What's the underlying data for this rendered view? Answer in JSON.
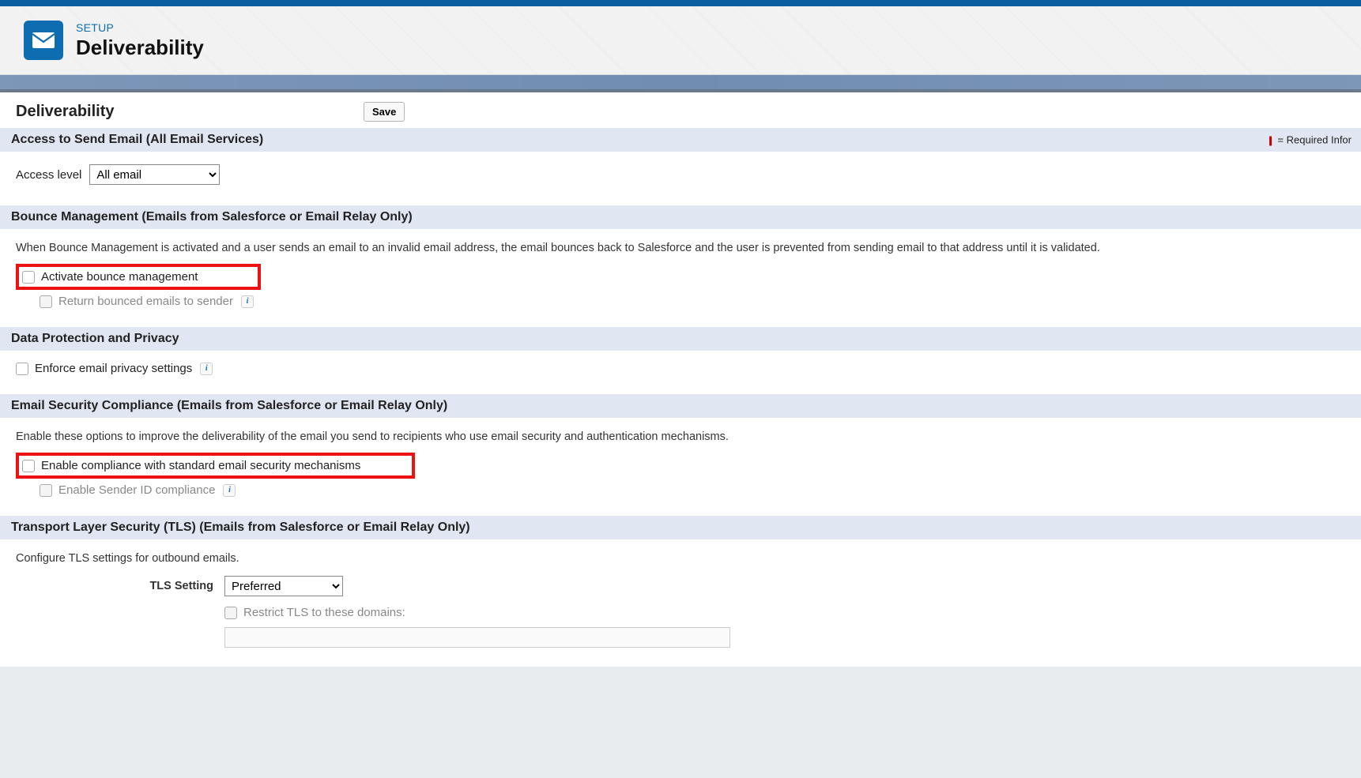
{
  "header": {
    "setup_label": "SETUP",
    "title": "Deliverability"
  },
  "panel": {
    "title": "Deliverability",
    "save_button": "Save",
    "required_note": "= Required Infor"
  },
  "sections": {
    "access": {
      "title": "Access to Send Email (All Email Services)",
      "field_label": "Access level",
      "selected": "All email"
    },
    "bounce": {
      "title": "Bounce Management (Emails from Salesforce or Email Relay Only)",
      "description": "When Bounce Management is activated and a user sends an email to an invalid email address, the email bounces back to Salesforce and the user is prevented from sending email to that address until it is validated.",
      "activate_label": "Activate bounce management",
      "return_label": "Return bounced emails to sender"
    },
    "privacy": {
      "title": "Data Protection and Privacy",
      "enforce_label": "Enforce email privacy settings"
    },
    "security": {
      "title": "Email Security Compliance (Emails from Salesforce or Email Relay Only)",
      "description": "Enable these options to improve the deliverability of the email you send to recipients who use email security and authentication mechanisms.",
      "enable_compliance_label": "Enable compliance with standard email security mechanisms",
      "enable_sender_id_label": "Enable Sender ID compliance"
    },
    "tls": {
      "title": "Transport Layer Security (TLS) (Emails from Salesforce or Email Relay Only)",
      "description": "Configure TLS settings for outbound emails.",
      "setting_label": "TLS Setting",
      "selected": "Preferred",
      "restrict_label": "Restrict TLS to these domains:"
    }
  }
}
